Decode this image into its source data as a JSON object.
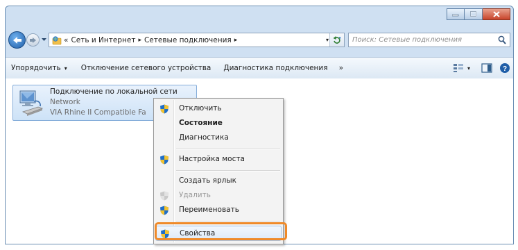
{
  "address_bar": {
    "overflow": "«",
    "crumbs": [
      "Сеть и Интернет",
      "Сетевые подключения"
    ],
    "separator": "▸",
    "dropdown": "▾"
  },
  "search": {
    "placeholder": "Поиск: Сетевые подключения"
  },
  "toolbar": {
    "organize": "Упорядочить",
    "disable": "Отключение сетевого устройства",
    "diagnose": "Диагностика подключения",
    "more": "»",
    "dropdown_arrow": "▾"
  },
  "connection": {
    "name": "Подключение по локальной сети",
    "status": "Network",
    "device": "VIA Rhine II Compatible Fa"
  },
  "context_menu": {
    "items": [
      {
        "label": "Отключить",
        "shield": true
      },
      {
        "label": "Состояние",
        "bold": true
      },
      {
        "label": "Диагностика"
      },
      {
        "label": "Настройка моста",
        "shield": true
      },
      {
        "label": "Создать ярлык"
      },
      {
        "label": "Удалить",
        "shield": true,
        "disabled": true
      },
      {
        "label": "Переименовать",
        "shield": true
      },
      {
        "label": "Свойства",
        "shield": true,
        "highlighted": true
      }
    ]
  },
  "colors": {
    "highlight_outline": "#ef8a2a",
    "toolbar_bg": "#dce8f4",
    "selection": "#cde2f7"
  },
  "icons": [
    "minimize-icon",
    "maximize-icon",
    "close-icon",
    "back-arrow-icon",
    "forward-arrow-icon",
    "network-folder-icon",
    "refresh-icon",
    "search-icon",
    "view-options-icon",
    "preview-pane-icon",
    "help-icon",
    "network-adapter-icon",
    "uac-shield-icon"
  ]
}
